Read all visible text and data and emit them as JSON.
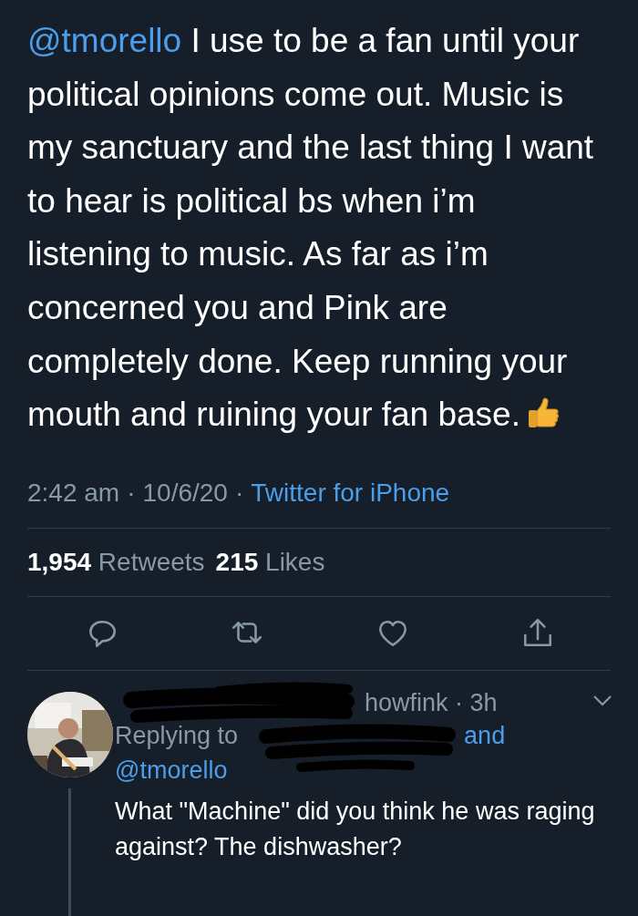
{
  "tweet": {
    "mention": "@tmorello",
    "text": "I use to be a fan until your political opinions come out. Music is my sanctuary and the last thing I want to hear is political bs when i’m listening to music. As far as i’m concerned you and Pink are completely done. Keep running your mouth and ruining your fan base.",
    "time": "2:42 am",
    "separator_1": "·",
    "date": "10/6/20",
    "separator_2": "·",
    "source": "Twitter for iPhone"
  },
  "stats": [
    {
      "count": "1,954",
      "label": "Retweets"
    },
    {
      "count": "215",
      "label": "Likes"
    }
  ],
  "actions": [
    {
      "kind": "reply"
    },
    {
      "kind": "retweet"
    },
    {
      "kind": "like"
    },
    {
      "kind": "share"
    }
  ],
  "reply": {
    "handle": "howfink · 3h",
    "replying_to": "Replying to",
    "and": "and",
    "mention": "@tmorello",
    "text": "What \"Machine\" did you think he was raging against? The dishwasher?"
  }
}
